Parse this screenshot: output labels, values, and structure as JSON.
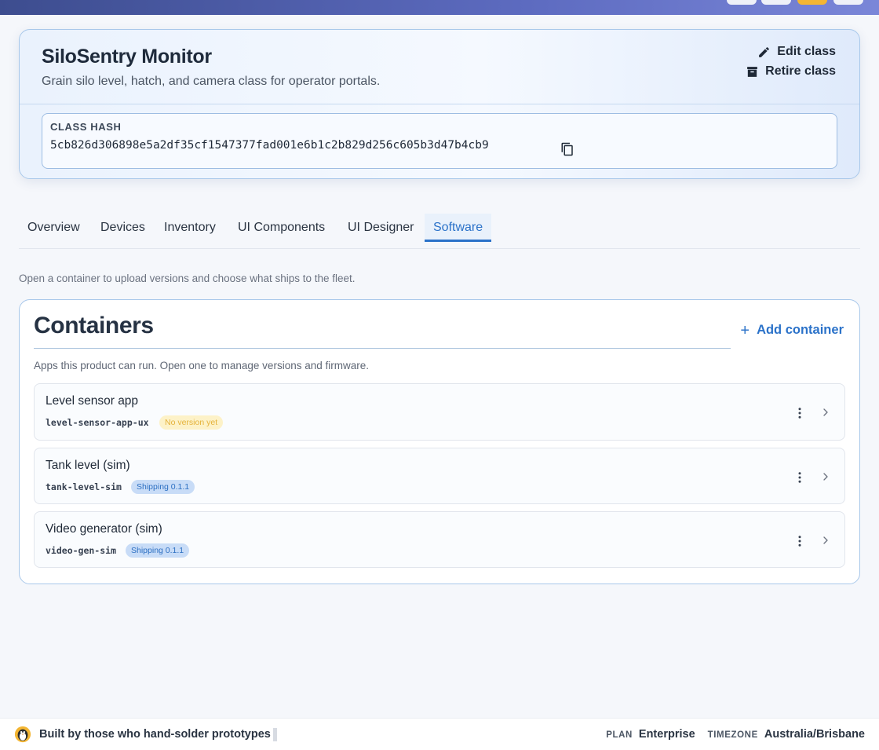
{
  "header": {
    "title": "SiloSentry Monitor",
    "subtitle": "Grain silo level, hatch, and camera class for operator portals.",
    "edit_label": "Edit class",
    "retire_label": "Retire class"
  },
  "hash": {
    "label": "CLASS HASH",
    "value": "5cb826d306898e5a2df35cf1547377fad001e6b1c2b829d256c605b3d47b4cb9",
    "copy_icon": "copy-icon"
  },
  "tabs": [
    {
      "label": "Overview"
    },
    {
      "label": "Devices"
    },
    {
      "label": "Inventory"
    },
    {
      "label": "UI Components"
    },
    {
      "label": "UI Designer"
    },
    {
      "label": "Software"
    }
  ],
  "active_tab": "Software",
  "hint": "Open a container to upload versions and choose what ships to the fleet.",
  "containers": {
    "title": "Containers",
    "add_label": "Add container",
    "subtitle": "Apps this product can run. Open one to manage versions and firmware.",
    "items": [
      {
        "name": "Level sensor app",
        "slug": "level-sensor-app-ux",
        "badge": "No version yet",
        "status": "warn"
      },
      {
        "name": "Tank level (sim)",
        "slug": "tank-level-sim",
        "badge": "Shipping 0.1.1",
        "status": "ok"
      },
      {
        "name": "Video generator (sim)",
        "slug": "video-gen-sim",
        "badge": "Shipping 0.1.1",
        "status": "ok"
      }
    ]
  },
  "footer": {
    "tagline": "Built by those who hand-solder prototypes",
    "plan_key": "PLAN",
    "plan_value": "Enterprise",
    "tz_key": "TIMEZONE",
    "tz_value": "Australia/Brisbane"
  },
  "colors": {
    "accent": "#2b72c9",
    "warn_badge_bg": "#fdf2c8",
    "ok_badge_bg": "#c8dcf7",
    "topbar": "#5d6bc0"
  }
}
